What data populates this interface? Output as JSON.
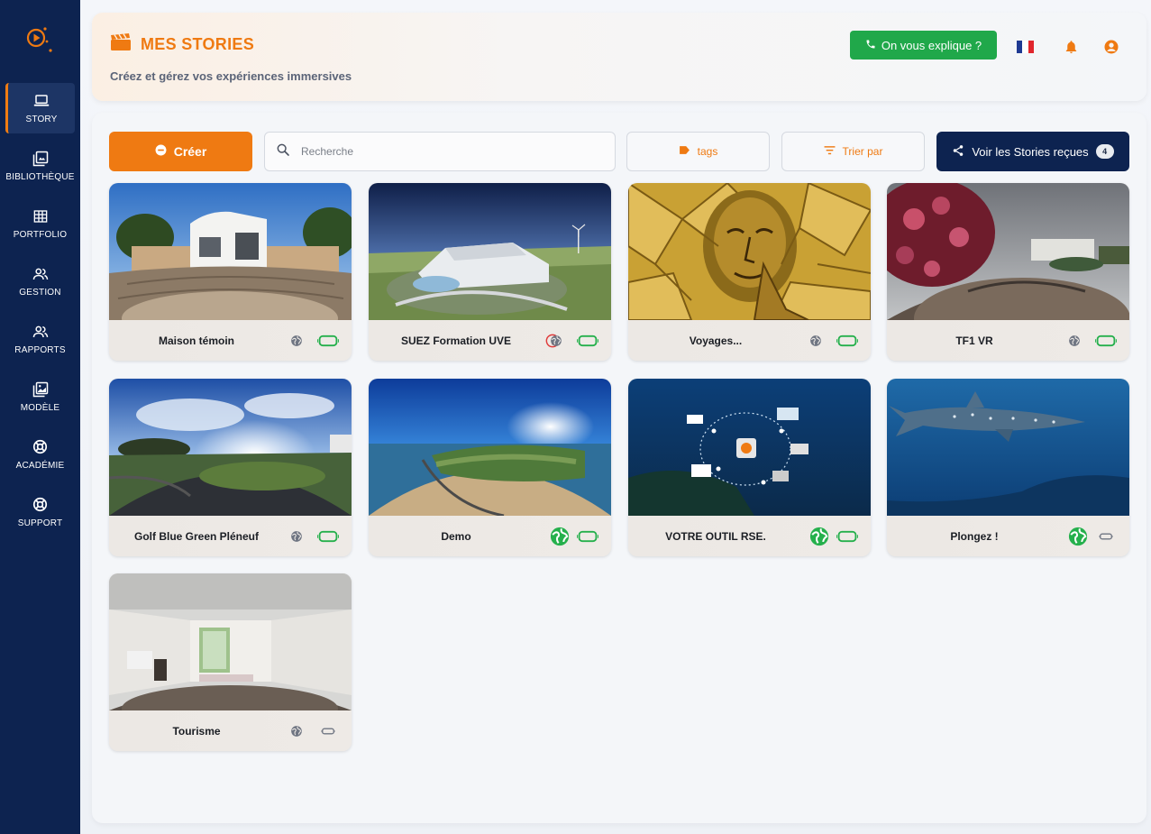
{
  "app": {
    "accent": "#ef7a12",
    "navy": "#0d2350",
    "green": "#20a84a"
  },
  "sidebar": {
    "items": [
      {
        "label": "STORY",
        "icon": "laptop-icon",
        "active": true
      },
      {
        "label": "BIBLIOTHÈQUE",
        "icon": "library-icon"
      },
      {
        "label": "PORTFOLIO",
        "icon": "grid-icon"
      },
      {
        "label": "GESTION",
        "icon": "users-icon"
      },
      {
        "label": "RAPPORTS",
        "icon": "users-icon"
      },
      {
        "label": "MODÈLE",
        "icon": "template-icon"
      },
      {
        "label": "ACADÉMIE",
        "icon": "lifebuoy-icon"
      },
      {
        "label": "SUPPORT",
        "icon": "lifebuoy-icon"
      }
    ]
  },
  "header": {
    "title": "MES STORIES",
    "subtitle": "Créez et gérez vos expériences immersives",
    "explain_label": "On vous explique ?"
  },
  "toolbar": {
    "create_label": "Créer",
    "search_placeholder": "Recherche",
    "tags_label": "tags",
    "sort_label": "Trier par",
    "received_label": "Voir les Stories reçues",
    "received_count": "4"
  },
  "stories": [
    {
      "name": "Maison témoin",
      "warning": false,
      "published": false,
      "vr_active": true,
      "scene": "house"
    },
    {
      "name": "SUEZ Formation UVE",
      "warning": true,
      "published": false,
      "vr_active": true,
      "scene": "building"
    },
    {
      "name": "Voyages...",
      "warning": false,
      "published": false,
      "vr_active": true,
      "scene": "stained"
    },
    {
      "name": "TF1 VR",
      "warning": false,
      "published": false,
      "vr_active": true,
      "scene": "garden"
    },
    {
      "name": "Golf Blue Green Pléneuf",
      "warning": false,
      "published": false,
      "vr_active": true,
      "scene": "golf"
    },
    {
      "name": "Demo",
      "warning": false,
      "published": true,
      "vr_active": true,
      "scene": "beach"
    },
    {
      "name": "VOTRE OUTIL RSE.",
      "warning": false,
      "published": true,
      "vr_active": true,
      "scene": "underwater-diagram"
    },
    {
      "name": "Plongez !",
      "warning": false,
      "published": true,
      "vr_active": false,
      "scene": "shark"
    },
    {
      "name": "Tourisme",
      "warning": false,
      "published": false,
      "vr_active": false,
      "scene": "room"
    }
  ]
}
